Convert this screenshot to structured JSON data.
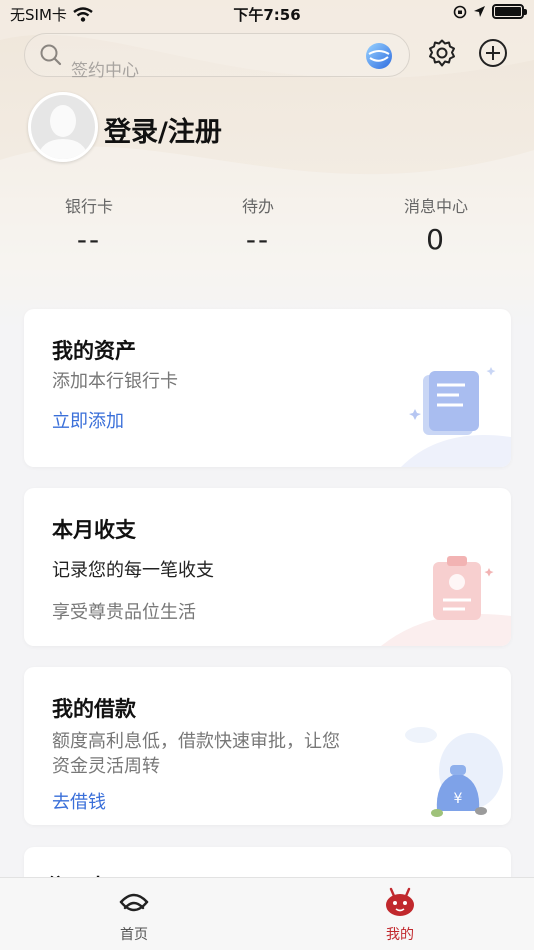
{
  "status_bar": {
    "carrier": "无SIM卡",
    "time": "下午7:56"
  },
  "header": {
    "search": {
      "placeholder": "签约中心",
      "icon": "search-icon",
      "voice_icon": "voice-assistant-icon"
    },
    "settings_icon": "gear-icon",
    "add_icon": "plus-circle-icon"
  },
  "profile": {
    "login_label": "登录/注册",
    "stats": [
      {
        "label": "银行卡",
        "value": "--"
      },
      {
        "label": "待办",
        "value": "--"
      },
      {
        "label": "消息中心",
        "value": "0"
      }
    ]
  },
  "cards": {
    "assets": {
      "title": "我的资产",
      "subtitle": "添加本行银行卡",
      "action": "立即添加"
    },
    "monthly": {
      "title": "本月收支",
      "line1": "记录您的每一笔收支",
      "line2": "享受尊贵品位生活"
    },
    "loan": {
      "title": "我的借款",
      "line1": "额度高利息低，借款快速审批，让您",
      "line2": "资金灵活周转",
      "action": "去借钱"
    },
    "partial": {
      "title": "信用卡"
    }
  },
  "tab_bar": {
    "tabs": [
      {
        "label": "首页",
        "icon": "home-logo-icon",
        "active": false
      },
      {
        "label": "我的",
        "icon": "mascot-icon",
        "active": true
      }
    ]
  },
  "colors": {
    "accent": "#c1282d",
    "link": "#3a6fd9",
    "background": "#f4f4f6"
  }
}
